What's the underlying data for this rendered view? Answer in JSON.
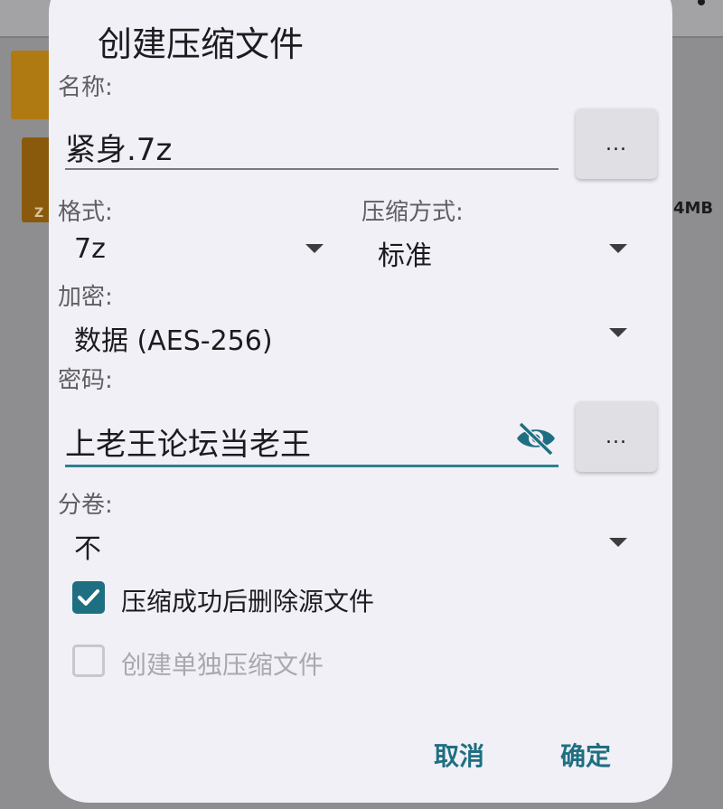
{
  "background": {
    "file_size_text": "4MB",
    "file_icon_letter": "Z"
  },
  "dialog": {
    "title": "创建压缩文件",
    "name_label": "名称:",
    "name_value": "紧身.7z",
    "name_browse_label": "...",
    "format_label": "格式:",
    "format_value": "7z",
    "compression_label": "压缩方式:",
    "compression_value": "标准",
    "encryption_label": "加密:",
    "encryption_value": "数据 (AES-256)",
    "password_label": "密码:",
    "password_value": "上老王论坛当老王",
    "password_more_label": "...",
    "split_label": "分卷:",
    "split_value": "不",
    "delete_source_label": "压缩成功后删除源文件",
    "delete_source_checked": true,
    "separate_archive_label": "创建单独压缩文件",
    "separate_archive_checked": false,
    "cancel_label": "取消",
    "ok_label": "确定"
  },
  "colors": {
    "accent": "#1f6f82",
    "dialog_bg": "#f1f0f6"
  }
}
